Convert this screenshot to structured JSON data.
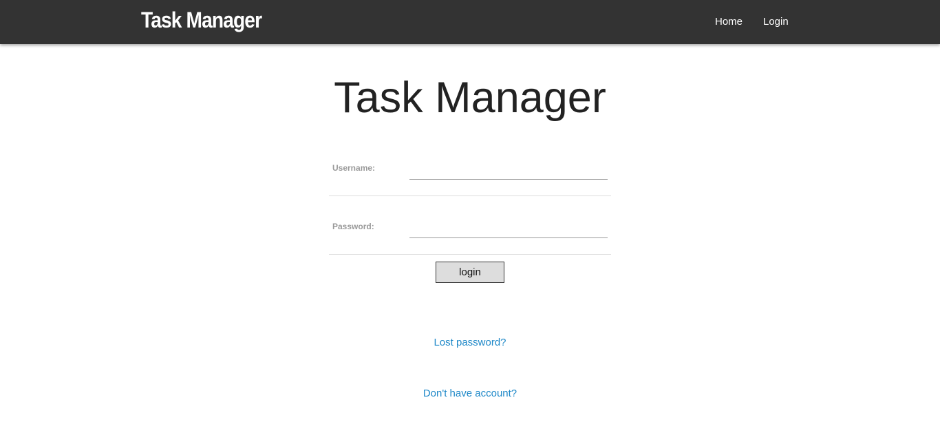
{
  "navbar": {
    "brand": "Task Manager",
    "links": [
      {
        "label": "Home"
      },
      {
        "label": "Login"
      }
    ],
    "background_color": "#333333"
  },
  "main": {
    "title": "Task Manager",
    "form": {
      "username_label": "Username:",
      "username_value": "",
      "password_label": "Password:",
      "password_value": "",
      "submit_label": "login"
    },
    "links": {
      "lost_password": "Lost password?",
      "no_account": "Don't have account?"
    },
    "link_color": "#1e88c8"
  }
}
